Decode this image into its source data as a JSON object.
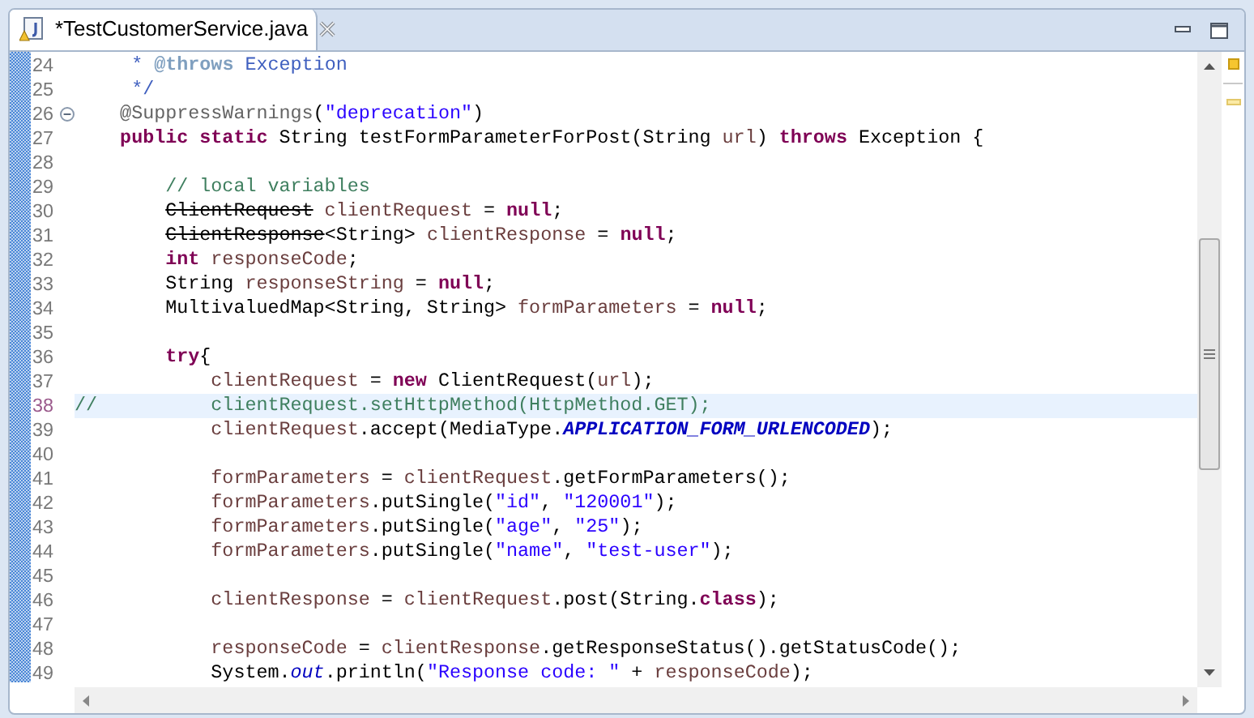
{
  "editor_tab": {
    "title": "*TestCustomerService.java",
    "selected": true
  },
  "lines": [
    {
      "number": "24",
      "selected": false,
      "foldable": false,
      "tokens": [
        {
          "kind": "doc",
          "text": "     * "
        },
        {
          "kind": "doctag",
          "text": "@throws"
        },
        {
          "kind": "doc",
          "text": " Exception"
        }
      ]
    },
    {
      "number": "25",
      "selected": false,
      "foldable": false,
      "tokens": [
        {
          "kind": "doc",
          "text": "     */"
        }
      ]
    },
    {
      "number": "26",
      "selected": false,
      "foldable": true,
      "tokens": [
        {
          "kind": "annotation",
          "text": "    @SuppressWarnings"
        },
        {
          "kind": "plain",
          "text": "("
        },
        {
          "kind": "string",
          "text": "\"deprecation\""
        },
        {
          "kind": "plain",
          "text": ")"
        }
      ]
    },
    {
      "number": "27",
      "selected": false,
      "foldable": false,
      "tokens": [
        {
          "kind": "keyword",
          "text": "    public "
        },
        {
          "kind": "keyword",
          "text": "static"
        },
        {
          "kind": "plain",
          "text": " String testFormParameterForPost(String "
        },
        {
          "kind": "local",
          "text": "url"
        },
        {
          "kind": "plain",
          "text": ") "
        },
        {
          "kind": "keyword",
          "text": "throws"
        },
        {
          "kind": "plain",
          "text": " Exception {"
        }
      ]
    },
    {
      "number": "28",
      "selected": false,
      "foldable": false
    },
    {
      "number": "29",
      "selected": false,
      "foldable": false,
      "tokens": [
        {
          "kind": "comment",
          "text": "        // local variables"
        }
      ]
    },
    {
      "number": "30",
      "selected": false,
      "foldable": false,
      "tokens": [
        {
          "kind": "deprecated",
          "text": "        ClientRequest"
        },
        {
          "kind": "local",
          "text": " clientRequest"
        },
        {
          "kind": "plain",
          "text": " = "
        },
        {
          "kind": "keyword",
          "text": "null"
        },
        {
          "kind": "plain",
          "text": ";"
        }
      ]
    },
    {
      "number": "31",
      "selected": false,
      "foldable": false,
      "tokens": [
        {
          "kind": "deprecated",
          "text": "        ClientResponse"
        },
        {
          "kind": "plain",
          "text": "<String> "
        },
        {
          "kind": "local",
          "text": "clientResponse"
        },
        {
          "kind": "plain",
          "text": " = "
        },
        {
          "kind": "keyword",
          "text": "null"
        },
        {
          "kind": "plain",
          "text": ";"
        }
      ]
    },
    {
      "number": "32",
      "selected": false,
      "foldable": false,
      "tokens": [
        {
          "kind": "keyword",
          "text": "        int"
        },
        {
          "kind": "local",
          "text": " responseCode"
        },
        {
          "kind": "plain",
          "text": ";"
        }
      ]
    },
    {
      "number": "33",
      "selected": false,
      "foldable": false,
      "tokens": [
        {
          "kind": "plain",
          "text": "        String "
        },
        {
          "kind": "local",
          "text": "responseString"
        },
        {
          "kind": "plain",
          "text": " = "
        },
        {
          "kind": "keyword",
          "text": "null"
        },
        {
          "kind": "plain",
          "text": ";"
        }
      ]
    },
    {
      "number": "34",
      "selected": false,
      "foldable": false,
      "tokens": [
        {
          "kind": "plain",
          "text": "        MultivaluedMap<String, String> "
        },
        {
          "kind": "local",
          "text": "formParameters"
        },
        {
          "kind": "plain",
          "text": " = "
        },
        {
          "kind": "keyword",
          "text": "null"
        },
        {
          "kind": "plain",
          "text": ";"
        }
      ]
    },
    {
      "number": "35",
      "selected": false,
      "foldable": false
    },
    {
      "number": "36",
      "selected": false,
      "foldable": false,
      "tokens": [
        {
          "kind": "keyword",
          "text": "        try"
        },
        {
          "kind": "plain",
          "text": "{"
        }
      ]
    },
    {
      "number": "37",
      "selected": false,
      "foldable": false,
      "tokens": [
        {
          "kind": "local",
          "text": "            clientRequest"
        },
        {
          "kind": "plain",
          "text": " = "
        },
        {
          "kind": "keyword",
          "text": "new"
        },
        {
          "kind": "plain",
          "text": " ClientRequest("
        },
        {
          "kind": "local",
          "text": "url"
        },
        {
          "kind": "plain",
          "text": ");"
        }
      ]
    },
    {
      "number": "38",
      "selected": true,
      "foldable": false,
      "tokens": [
        {
          "kind": "comment",
          "text": "//          clientRequest.setHttpMethod(HttpMethod.GET);"
        }
      ]
    },
    {
      "number": "39",
      "selected": false,
      "foldable": false,
      "tokens": [
        {
          "kind": "local",
          "text": "            clientRequest"
        },
        {
          "kind": "plain",
          "text": ".accept(MediaType."
        },
        {
          "kind": "constant",
          "text": "APPLICATION_FORM_URLENCODED"
        },
        {
          "kind": "plain",
          "text": ");"
        }
      ]
    },
    {
      "number": "40",
      "selected": false,
      "foldable": false
    },
    {
      "number": "41",
      "selected": false,
      "foldable": false,
      "tokens": [
        {
          "kind": "local",
          "text": "            formParameters"
        },
        {
          "kind": "plain",
          "text": " = "
        },
        {
          "kind": "local",
          "text": "clientRequest"
        },
        {
          "kind": "plain",
          "text": ".getFormParameters();"
        }
      ]
    },
    {
      "number": "42",
      "selected": false,
      "foldable": false,
      "tokens": [
        {
          "kind": "local",
          "text": "            formParameters"
        },
        {
          "kind": "plain",
          "text": ".putSingle("
        },
        {
          "kind": "string",
          "text": "\"id\""
        },
        {
          "kind": "plain",
          "text": ", "
        },
        {
          "kind": "string",
          "text": "\"120001\""
        },
        {
          "kind": "plain",
          "text": ");"
        }
      ]
    },
    {
      "number": "43",
      "selected": false,
      "foldable": false,
      "tokens": [
        {
          "kind": "local",
          "text": "            formParameters"
        },
        {
          "kind": "plain",
          "text": ".putSingle("
        },
        {
          "kind": "string",
          "text": "\"age\""
        },
        {
          "kind": "plain",
          "text": ", "
        },
        {
          "kind": "string",
          "text": "\"25\""
        },
        {
          "kind": "plain",
          "text": ");"
        }
      ]
    },
    {
      "number": "44",
      "selected": false,
      "foldable": false,
      "tokens": [
        {
          "kind": "local",
          "text": "            formParameters"
        },
        {
          "kind": "plain",
          "text": ".putSingle("
        },
        {
          "kind": "string",
          "text": "\"name\""
        },
        {
          "kind": "plain",
          "text": ", "
        },
        {
          "kind": "string",
          "text": "\"test-user\""
        },
        {
          "kind": "plain",
          "text": ");"
        }
      ]
    },
    {
      "number": "45",
      "selected": false,
      "foldable": false
    },
    {
      "number": "46",
      "selected": false,
      "foldable": false,
      "tokens": [
        {
          "kind": "local",
          "text": "            clientResponse"
        },
        {
          "kind": "plain",
          "text": " = "
        },
        {
          "kind": "local",
          "text": "clientRequest"
        },
        {
          "kind": "plain",
          "text": ".post(String."
        },
        {
          "kind": "keyword",
          "text": "class"
        },
        {
          "kind": "plain",
          "text": ");"
        }
      ]
    },
    {
      "number": "47",
      "selected": false,
      "foldable": false
    },
    {
      "number": "48",
      "selected": false,
      "foldable": false,
      "tokens": [
        {
          "kind": "local",
          "text": "            responseCode"
        },
        {
          "kind": "plain",
          "text": " = "
        },
        {
          "kind": "local",
          "text": "clientResponse"
        },
        {
          "kind": "plain",
          "text": ".getResponseStatus().getStatusCode();"
        }
      ]
    },
    {
      "number": "49",
      "selected": false,
      "foldable": false,
      "tokens": [
        {
          "kind": "plain",
          "text": "            System."
        },
        {
          "kind": "static",
          "text": "out"
        },
        {
          "kind": "plain",
          "text": ".println("
        },
        {
          "kind": "string",
          "text": "\"Response code: \""
        },
        {
          "kind": "plain",
          "text": " + "
        },
        {
          "kind": "local",
          "text": "responseCode"
        },
        {
          "kind": "plain",
          "text": ");"
        }
      ]
    }
  ]
}
